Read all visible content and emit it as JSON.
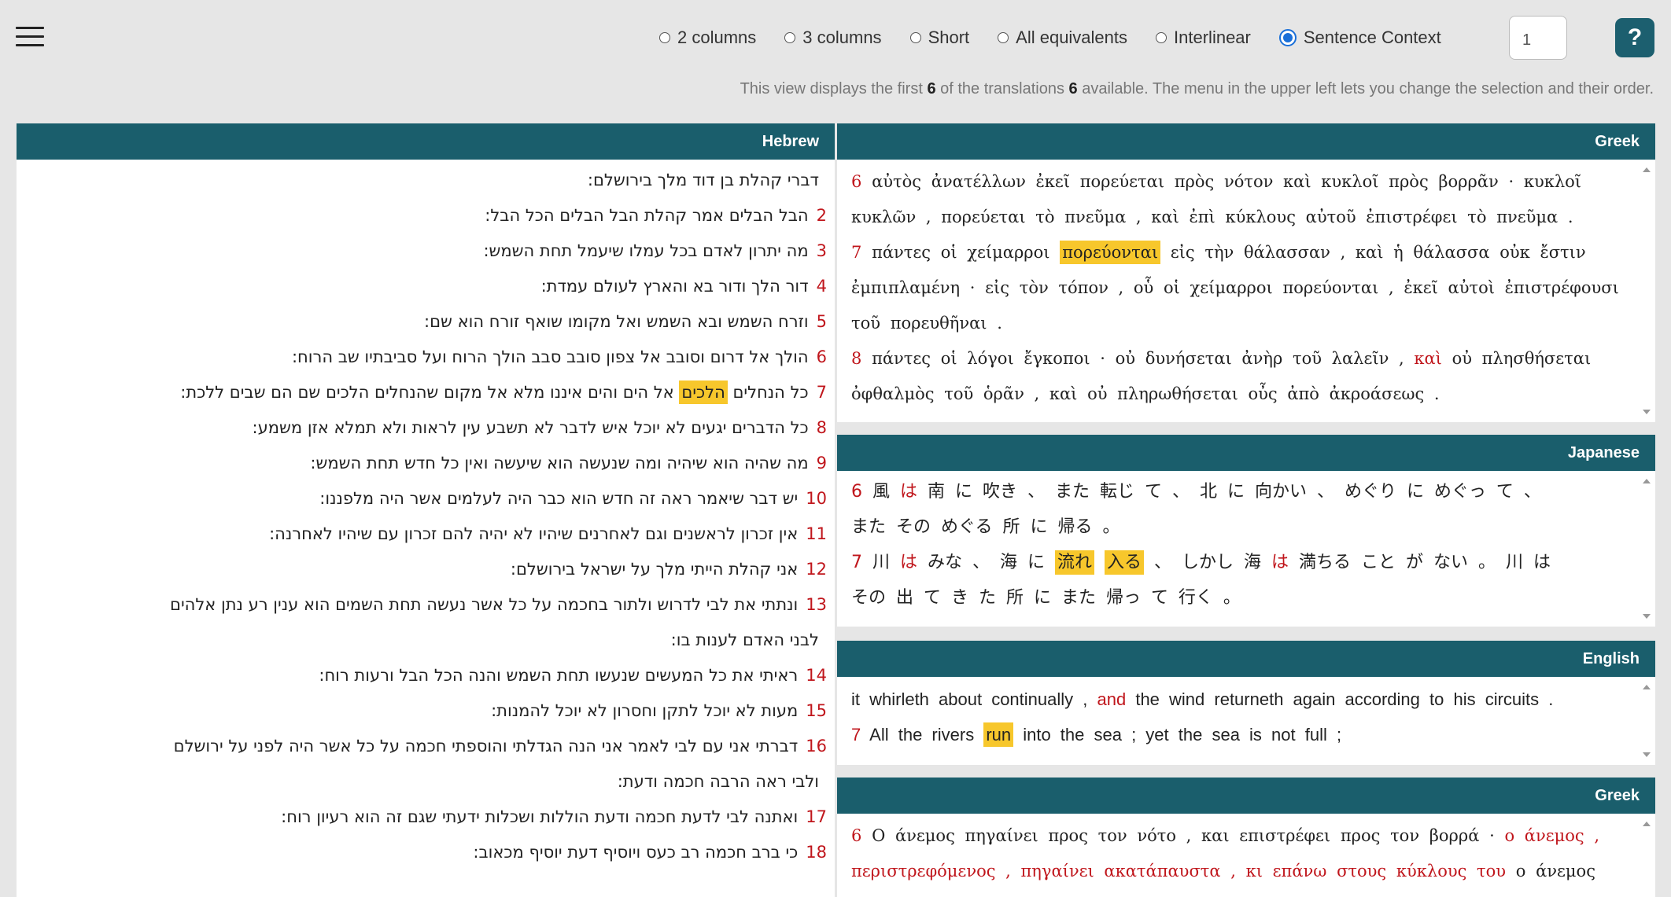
{
  "toolbar": {
    "options": [
      {
        "label": "2 columns",
        "checked": false
      },
      {
        "label": "3 columns",
        "checked": false
      },
      {
        "label": "Short",
        "checked": false
      },
      {
        "label": "All equivalents",
        "checked": false
      },
      {
        "label": "Interlinear",
        "checked": false
      },
      {
        "label": "Sentence Context",
        "checked": true
      }
    ],
    "count_value": "1",
    "help_label": "?"
  },
  "info": {
    "part1": "This view displays the first ",
    "shown": "6",
    "part2": " of the translations ",
    "total": "6",
    "part3": " available. The menu in the upper left lets you change the selection and their order."
  },
  "hebrew": {
    "header": "Hebrew",
    "verses": [
      {
        "n": "",
        "text": "דברי קהלת בן דוד מלך בירושלם:"
      },
      {
        "n": "2",
        "text": "הבל הבלים אמר קהלת הבל הבלים הכל הבל:"
      },
      {
        "n": "3",
        "text": "מה יתרון לאדם בכל עמלו שיעמל תחת השמש:"
      },
      {
        "n": "4",
        "text": "דור הלך ודור בא והארץ לעולם עמדת:"
      },
      {
        "n": "5",
        "text": "וזרח השמש ובא השמש ואל מקומו שואף זורח הוא שם:"
      },
      {
        "n": "6",
        "text": "הולך אל דרום וסובב אל צפון סובב סבב הולך הרוח ועל סביבתיו שב הרוח:"
      },
      {
        "n": "7",
        "pre": "כל הנחלים ",
        "hl": "הלכים",
        "post": " אל הים והים איננו מלא אל מקום שהנחלים הלכים שם הם שבים ללכת:"
      },
      {
        "n": "8",
        "text": "כל הדברים יגעים לא יוכל איש לדבר לא תשבע עין לראות ולא תמלא אזן משמע:"
      },
      {
        "n": "9",
        "text": "מה שהיה הוא שיהיה ומה שנעשה הוא שיעשה ואין כל חדש תחת השמש:"
      },
      {
        "n": "10",
        "text": "יש דבר שיאמר ראה זה חדש הוא כבר היה לעלמים אשר היה מלפננו:"
      },
      {
        "n": "11",
        "text": "אין זכרון לראשנים וגם לאחרנים שיהיו לא יהיה להם זכרון עם שיהיו לאחרנה:"
      },
      {
        "n": "12",
        "text": "אני קהלת הייתי מלך על ישראל בירושלם:"
      },
      {
        "n": "13",
        "text": "ונתתי את לבי לדרוש ולתור בחכמה על כל אשר נעשה תחת השמים הוא ענין רע נתן אלהים"
      },
      {
        "n": "",
        "text": "לבני האדם לענות בו:"
      },
      {
        "n": "14",
        "text": "ראיתי את כל המעשים שנעשו תחת השמש והנה הכל הבל ורעות רוח:"
      },
      {
        "n": "15",
        "text": "מעות לא יוכל לתקן וחסרון לא יוכל להמנות:"
      },
      {
        "n": "16",
        "text": "דברתי אני עם לבי לאמר אני הנה הגדלתי והוספתי חכמה על כל אשר היה לפני על ירושלם"
      },
      {
        "n": "",
        "text": "ולבי ראה הרבה חכמה ודעת:"
      },
      {
        "n": "17",
        "text": "ואתנה לבי לדעת חכמה ודעת הוללות ושכלות ידעתי שגם זה הוא רעיון רוח:"
      },
      {
        "n": "18",
        "text": "כי ברב חכמה רב כעס ויוסיף דעת יוסיף מכאוב:"
      }
    ]
  },
  "greek1": {
    "header": "Greek",
    "l1": {
      "n": "6",
      "text": "αὐτὸς ἀνατέλλων ἐκεῖ πορεύεται πρὸς νότον καὶ κυκλοῖ πρὸς βορρᾶν · κυκλοῖ"
    },
    "l2": {
      "text": "κυκλῶν , πορεύεται τὸ πνεῦμα , καὶ ἐπὶ κύκλους αὐτοῦ ἐπιστρέφει τὸ πνεῦμα ."
    },
    "l3": {
      "n": "7",
      "pre": "πάντες οἱ χείμαρροι ",
      "hl": "πορεύονται",
      "post": " εἰς τὴν θάλασσαν , καὶ ἡ θάλασσα οὐκ ἔστιν"
    },
    "l4": {
      "text": "ἐμπιπλαμένη · εἰς τὸν τόπον , οὗ οἱ χείμαρροι πορεύονται , ἐκεῖ αὐτοὶ ἐπιστρέφουσι"
    },
    "l5": {
      "text": "τοῦ πορευθῆναι ."
    },
    "l6": {
      "n": "8",
      "pre": "πάντες οἱ λόγοι ἔγκοποι · οὐ δυνήσεται ἀνὴρ τοῦ λαλεῖν , ",
      "red": "καὶ",
      "post": " οὐ πλησθήσεται"
    },
    "l7": {
      "text": "ὀφθαλμὸς τοῦ ὁρᾶν , καὶ οὐ πληρωθήσεται οὖς ἀπὸ ἀκροάσεως ."
    }
  },
  "japanese": {
    "header": "Japanese",
    "l1": {
      "n": "6",
      "a": "風",
      "b": "は",
      "c": "南 に 吹き 、 また 転じ て 、 北 に 向かい 、 めぐり に めぐっ て 、"
    },
    "l2": {
      "text": "また その めぐる 所 に 帰る 。"
    },
    "l3": {
      "n": "7",
      "a": "川",
      "b": "は",
      "c": "みな 、 海 に ",
      "hl1": "流れ",
      "hl2": "入る",
      "d": " 、 しかし 海 ",
      "e": "は",
      "f": " 満ちる こと が ない 。 川 は"
    },
    "l4": {
      "text": "その 出 て き た 所 に また 帰っ て 行く 。"
    }
  },
  "english": {
    "header": "English",
    "l1": {
      "pre": "it whirleth about continually , ",
      "red": "and",
      "post": " the wind returneth again according to his circuits ."
    },
    "l2": {
      "n": "7",
      "pre": "All the rivers ",
      "hl": "run",
      "post": " into the sea ; yet the sea is not full ;"
    }
  },
  "greek2": {
    "header": "Greek",
    "l1": {
      "n": "6",
      "pre": "Ο άνεμος πηγαίνει προς τον νότο , και επιστρέφει προς τον βορρά · ",
      "red": "ο άνεμος ,"
    },
    "l2": {
      "red": "περιστρεφόμενος , πηγαίνει ακατάπαυστα , κι επάνω στους κύκλους του",
      "post": " ο άνεμος"
    }
  }
}
